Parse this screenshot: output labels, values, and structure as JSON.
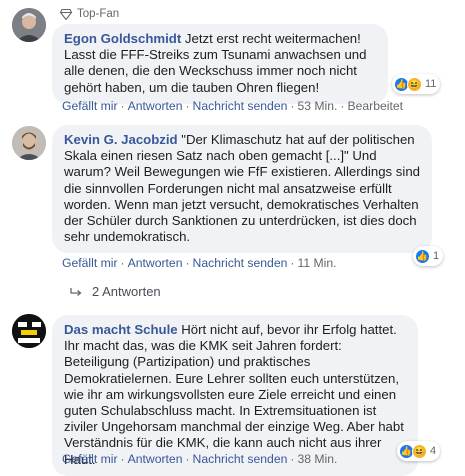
{
  "comments": [
    {
      "badge": "Top-Fan",
      "author": "Egon Goldschmidt",
      "text": "Jetzt erst recht weitermachen! Lasst die FFF-Streiks zum Tsunami anwachsen und alle denen, die den Weckschuss immer noch nicht gehört haben, um die tauben Ohren fliegen!",
      "actions": {
        "like": "Gefällt mir",
        "reply": "Antworten",
        "message": "Nachricht senden",
        "time": "53 Min.",
        "edited": "Bearbeitet"
      },
      "reactions": {
        "icons": [
          "like-icon",
          "haha-icon"
        ],
        "count": "11"
      }
    },
    {
      "author": "Kevin G. Jacobzid",
      "text": "\"Der Klimaschutz hat auf der politischen Skala einen riesen Satz nach oben gemacht [...]\" Und warum? Weil Bewegungen wie FfF existieren. Allerdings sind die sinnvollen Forderungen nicht mal ansatzweise erfüllt worden. Wenn man jetzt versucht, demokratisches Verhalten der Schüler durch Sanktionen zu unterdrücken, ist dies doch sehr undemokratisch.",
      "actions": {
        "like": "Gefällt mir",
        "reply": "Antworten",
        "message": "Nachricht senden",
        "time": "11 Min."
      },
      "reactions": {
        "icons": [
          "like-icon"
        ],
        "count": "1"
      },
      "replies_label": "2 Antworten"
    },
    {
      "author": "Das macht Schule",
      "avatar_text": "DAS MACHT SCHULE",
      "text": "Hört nicht auf, bevor ihr Erfolg hattet. Ihr macht das, was die KMK seit Jahren fordert: Beteiligung (Partizipation) und praktisches Demokratielernen. Eure Lehrer sollten euch unterstützen, wie ihr am wirkungsvollsten eure Ziele erreicht und einen guten Schulabschluss macht. In Extremsituationen ist ziviler Ungehorsam manchmal der einzige Weg. Aber habt Verständnis für die KMK, die kann auch nicht aus ihrer Haut.",
      "actions": {
        "like": "Gefällt mir",
        "reply": "Antworten",
        "message": "Nachricht senden",
        "time": "38 Min."
      },
      "reactions": {
        "icons": [
          "like-icon",
          "haha-icon"
        ],
        "count": "4"
      }
    }
  ]
}
